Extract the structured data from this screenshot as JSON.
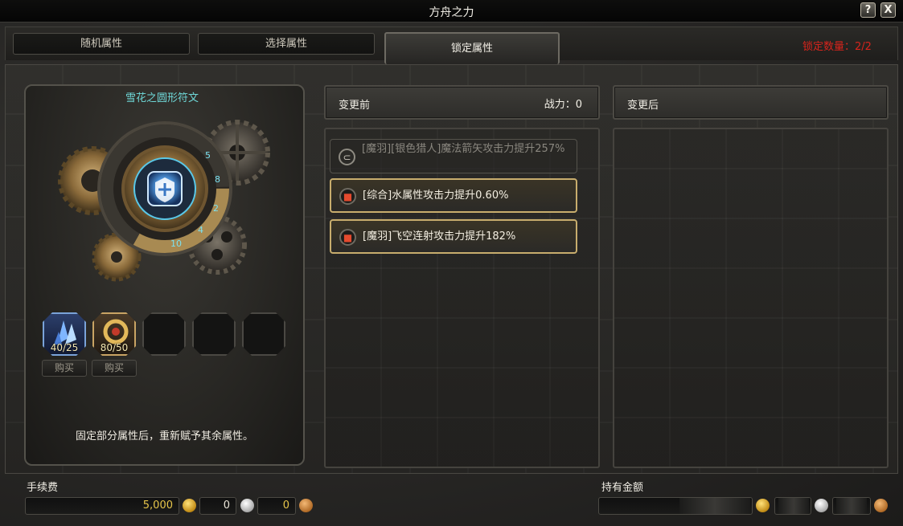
{
  "window": {
    "title": "方舟之力"
  },
  "titlebar_buttons": {
    "help": "?",
    "close": "X"
  },
  "tabs": [
    {
      "label": "随机属性",
      "active": false
    },
    {
      "label": "选择属性",
      "active": false
    },
    {
      "label": "锁定属性",
      "active": true
    }
  ],
  "lock_count": "锁定数量：2/2",
  "rune": {
    "name": "雪花之圆形符文",
    "description": "固定部分属性后，重新赋予其余属性。"
  },
  "materials": [
    {
      "qty": "40/25",
      "buy_label": "购买",
      "icon": "blue-crystal-icon"
    },
    {
      "qty": "80/50",
      "buy_label": "购买",
      "icon": "gold-ring-icon"
    }
  ],
  "before": {
    "header": "变更前",
    "power": "战力：0",
    "attributes": [
      {
        "text": "[魔羽][银色猎人]魔法箭矢攻击力提升257%",
        "locked": false,
        "icon": "unlock-icon"
      },
      {
        "text": "[综合]水属性攻击力提升0.60%",
        "locked": true,
        "icon": "lock-icon"
      },
      {
        "text": "[魔羽]飞空连射攻击力提升182%",
        "locked": true,
        "icon": "lock-icon"
      }
    ]
  },
  "after": {
    "header": "变更后"
  },
  "fee": {
    "label": "手续费",
    "gold": "5,000",
    "silver": "0",
    "copper": "0"
  },
  "owned": {
    "label": "持有金额"
  },
  "colors": {
    "lock_count": "#d8241c",
    "rune_name": "#6fd8d8",
    "locked_border": "#c8ad6d"
  }
}
